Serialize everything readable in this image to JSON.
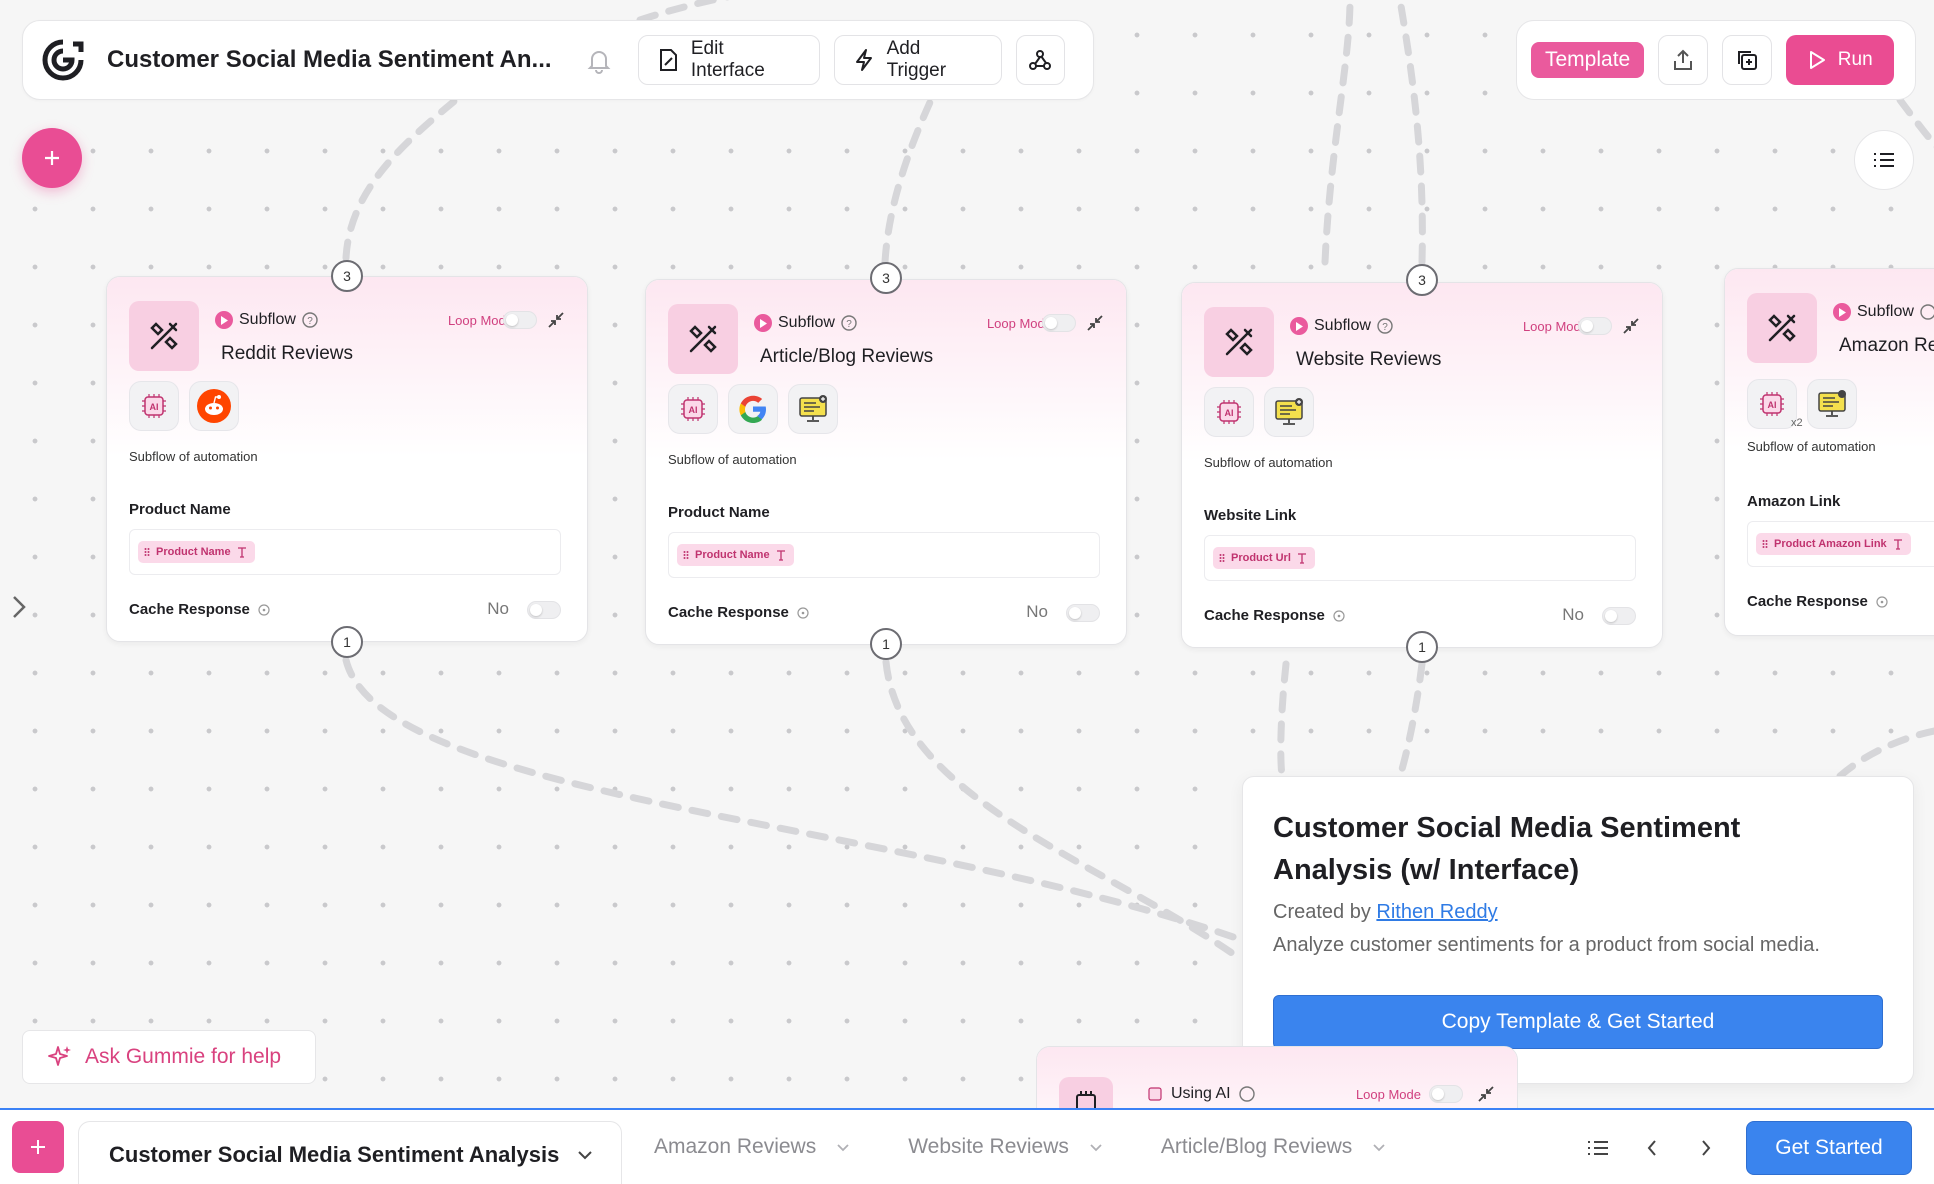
{
  "header": {
    "app_title": "Customer Social Media Sentiment An...",
    "edit_interface_label": "Edit Interface",
    "add_trigger_label": "Add Trigger",
    "template_label": "Template",
    "run_label": "Run"
  },
  "nodes": [
    {
      "type_label": "Subflow",
      "title": "Reddit Reviews",
      "loop_label": "Loop Mode",
      "desc": "Subflow of automation",
      "field_label": "Product Name",
      "chip": "Product Name",
      "cache_label": "Cache Response",
      "cache_value": "No",
      "in_port": "3",
      "out_port": "1",
      "tools": [
        "ai-chip-icon",
        "reddit-icon"
      ]
    },
    {
      "type_label": "Subflow",
      "title": "Article/Blog Reviews",
      "loop_label": "Loop Mode",
      "desc": "Subflow of automation",
      "field_label": "Product Name",
      "chip": "Product Name",
      "cache_label": "Cache Response",
      "cache_value": "No",
      "in_port": "3",
      "out_port": "1",
      "tools": [
        "ai-chip-icon",
        "google-icon",
        "web-scraper-icon"
      ]
    },
    {
      "type_label": "Subflow",
      "title": "Website Reviews",
      "loop_label": "Loop Mode",
      "desc": "Subflow of automation",
      "field_label": "Website Link",
      "chip": "Product Url",
      "cache_label": "Cache Response",
      "cache_value": "No",
      "in_port": "3",
      "out_port": "1",
      "tools": [
        "ai-chip-icon",
        "web-scraper-icon"
      ]
    },
    {
      "type_label": "Subflow",
      "title": "Amazon Re",
      "desc": "Subflow of automation",
      "field_label": "Amazon Link",
      "chip": "Product Amazon Link",
      "cache_label": "Cache Response",
      "tool_badge": "x2",
      "tools": [
        "ai-chip-icon",
        "web-scraper-icon"
      ]
    }
  ],
  "popup": {
    "title": "Customer Social Media Sentiment Analysis (w/ Interface)",
    "created_by_prefix": "Created by",
    "author": "Rithen Reddy",
    "description": "Analyze customer sentiments for a product from social media.",
    "cta": "Copy Template & Get Started"
  },
  "ask_help_label": "Ask Gummie for help",
  "partial_node": {
    "type_label": "Using AI",
    "loop_label": "Loop Mode"
  },
  "bottom_bar": {
    "active_tab": "Customer Social Media Sentiment Analysis",
    "tabs": [
      "Amazon Reviews",
      "Website Reviews",
      "Article/Blog Reviews"
    ],
    "get_started_label": "Get Started"
  },
  "colors": {
    "accent_pink": "#ea5a9d",
    "primary_blue": "#3a84ee"
  }
}
